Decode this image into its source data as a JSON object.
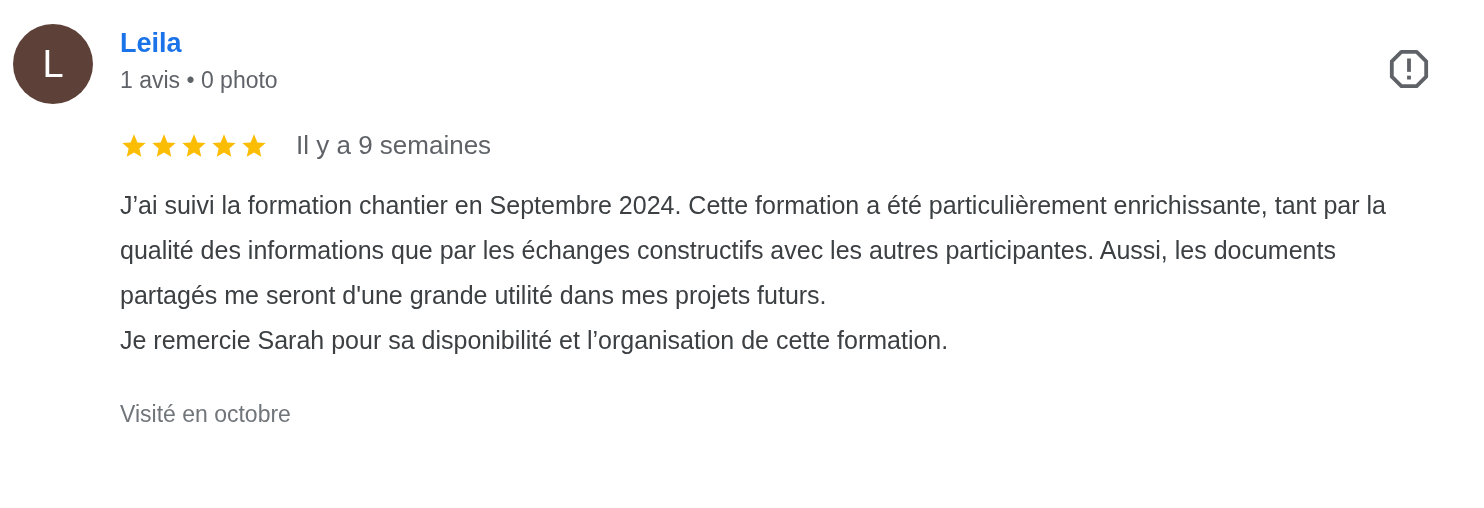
{
  "reviewer": {
    "initial": "L",
    "name": "Leila",
    "meta": "1 avis • 0 photo"
  },
  "review": {
    "stars": 5,
    "time": "Il y a 9 semaines",
    "paragraphs": [
      "J’ai suivi la formation chantier en Septembre 2024. Cette formation a été particulièrement enrichissante, tant par la qualité des informations que par les échanges constructifs avec les autres participantes. Aussi, les documents partagés me seront d'une grande utilité dans mes projets futurs.",
      "Je remercie Sarah pour sa disponibilité et l’organisation de cette formation."
    ],
    "visited": "Visité en octobre"
  }
}
